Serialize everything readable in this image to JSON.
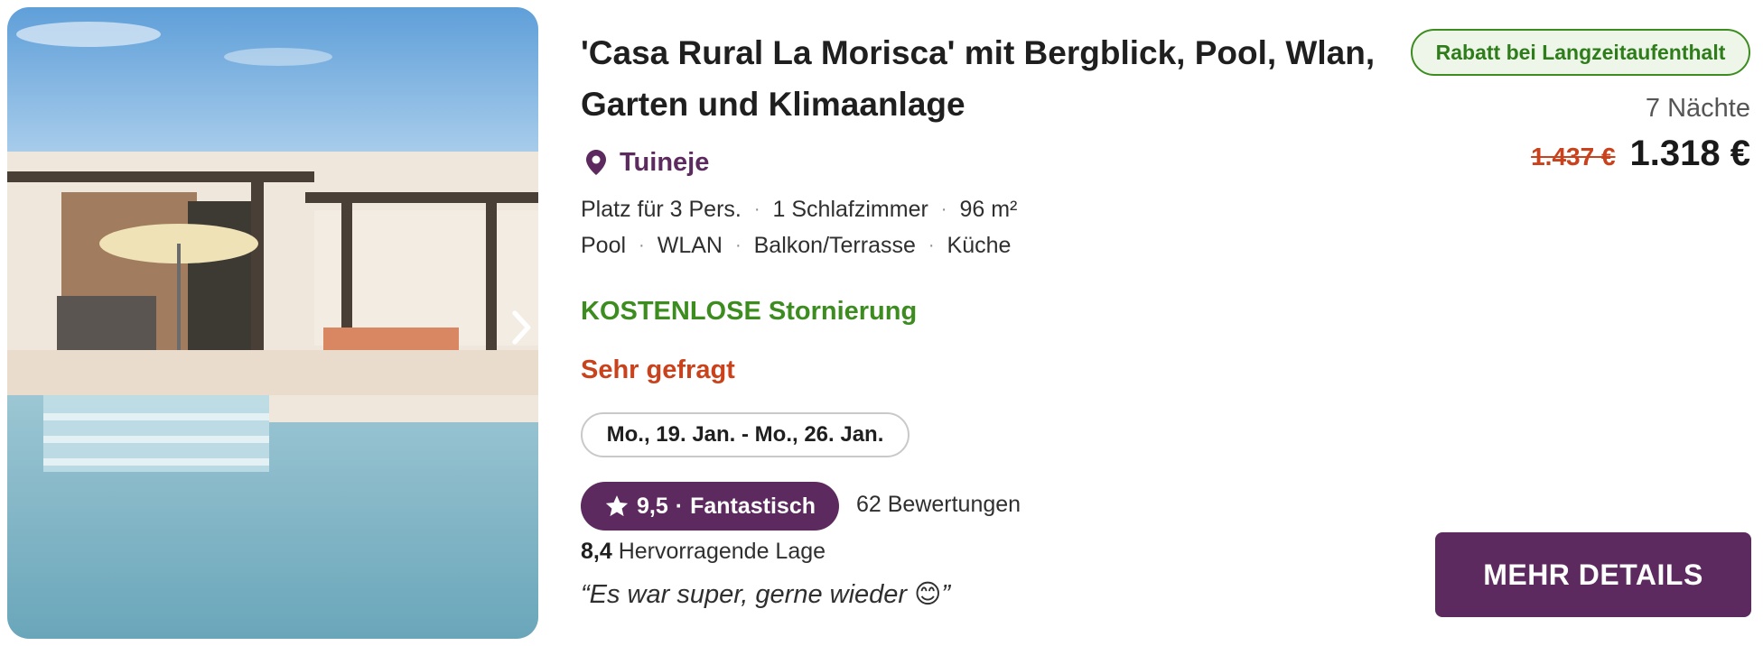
{
  "listing": {
    "title": "'Casa Rural La Morisca' mit Bergblick, Pool, Wlan, Garten und Klimaanlage",
    "location": "Tuineje",
    "location_icon": "map-pin-icon",
    "facts_row1": [
      "Platz für 3 Pers.",
      "1 Schlafzimmer",
      "96 m²"
    ],
    "facts_row2": [
      "Pool",
      "WLAN",
      "Balkon/Terrasse",
      "Küche"
    ],
    "separator": "·",
    "free_cancellation": "KOSTENLOSE Stornierung",
    "demand": "Sehr gefragt",
    "dates": "Mo., 19. Jan. - Mo., 26. Jan.",
    "rating": {
      "score": "9,5",
      "label": "Fantastisch",
      "reviews": "62 Bewertungen",
      "location_score": "8,4",
      "location_label": "Hervorragende Lage"
    },
    "quote": "“Es war super, gerne wieder 😊”"
  },
  "pricing": {
    "badge": "Rabatt bei Langzeitaufenthalt",
    "nights": "7 Nächte",
    "old_price": "1.437 €",
    "new_price": "1.318 €"
  },
  "actions": {
    "details_label": "MEHR DETAILS"
  },
  "colors": {
    "brand": "#5c2a5e",
    "success": "#3c8c1f",
    "alert": "#c9421c"
  }
}
